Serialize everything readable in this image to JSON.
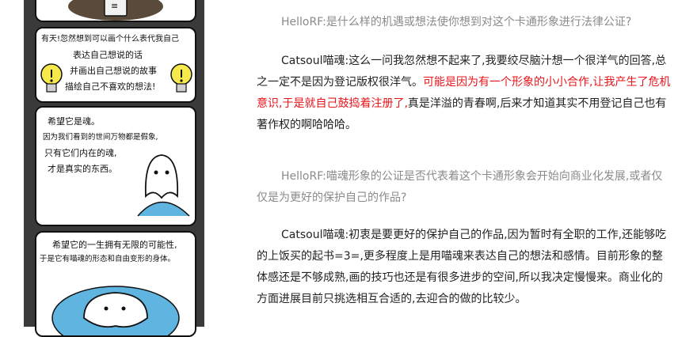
{
  "comic": {
    "panel1": {
      "sign": "≡"
    },
    "panel2": {
      "lines": [
        "有天!忽然想到可以画个什么表代我自己",
        "表达自己想说的话",
        "并画出自己想说的故事",
        "描绘自己不喜欢的想法!"
      ]
    },
    "panel3": {
      "lines": [
        "希望它是魂。",
        "因为我们看到的世间万物都是假象,",
        "只有它们内在的魂,",
        "才是真实的东西。"
      ]
    },
    "panel4": {
      "lines": [
        "希望它的一生拥有无限的可能性,",
        "于是它有喵魂的形态和自由变形的身体。"
      ]
    }
  },
  "article": {
    "q1": "HelloRF:是什么样的机遇或想法使你想到对这个卡通形象进行法律公证?",
    "a1_prefix": "Catsoul喵魂:这么一问我忽然想不起来了,我要绞尽脑汁想一个很洋气的回答,总之一定不是因为登记版权很洋气。",
    "a1_highlight": "可能是因为有一个形象的小小合作,让我产生了危机意识,于是就自己鼓捣着注册了,",
    "a1_suffix": "真是洋溢的青春啊,后来才知道其实不用登记自己也有著作权的啊哈哈哈。",
    "q2": "HelloRF:喵魂形象的公证是否代表着这个卡通形象会开始向商业化发展,或者仅仅是为更好的保护自己的作品?",
    "a2": "Catsoul喵魂:初衷是要更好的保护自己的作品,因为暂时有全职的工作,还能够吃的上饭买的起书=3=,更多程度上是用喵魂来表达自己的想法和感情。目前形象的整体感还是不够成熟,画的技巧也还是有很多进步的空间,所以我决定慢慢来。商业化的方面进展目前只挑选相互合适的,去迎合的做的比较少。"
  },
  "colors": {
    "highlight": "#e8141a",
    "question": "#8a8a8a",
    "answer": "#222222",
    "strip_bg": "#3a3a3a"
  }
}
